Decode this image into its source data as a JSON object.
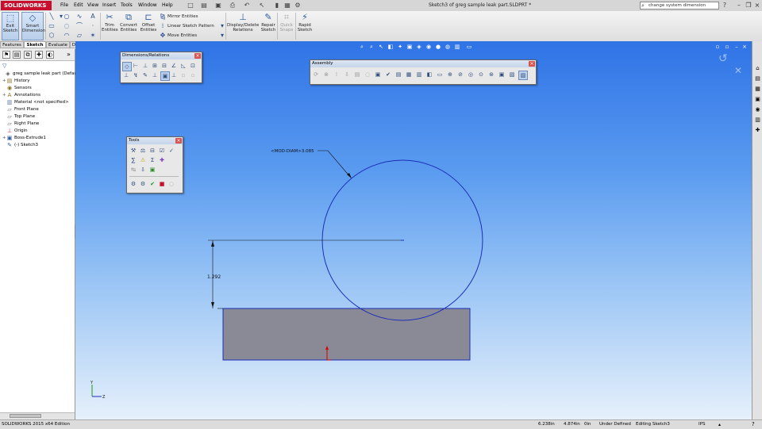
{
  "app": {
    "logo": "SOLIDWORKS",
    "menus": [
      "File",
      "Edit",
      "View",
      "Insert",
      "Tools",
      "Window",
      "Help"
    ],
    "doc_title": "Sketch3 of greg sample leak part.SLDPRT *",
    "search_placeholder": "change system dimension",
    "brand_color": "#c8102e"
  },
  "command_manager": {
    "exit_sketch": "Exit Sketch",
    "smart_dimension": "Smart Dimension",
    "trim_entities": "Trim Entities",
    "convert_entities": "Convert Entities",
    "offset_entities": "Offset Entities",
    "mirror_entities": "Mirror Entities",
    "linear_sketch_pattern": "Linear Sketch Pattern",
    "move_entities": "Move Entities",
    "display_delete_relations": "Display/Delete Relations",
    "repair_sketch": "Repair Sketch",
    "quick_snaps": "Quick Snaps",
    "rapid_sketch": "Rapid Sketch"
  },
  "tabs": [
    "Features",
    "Sketch",
    "Evaluate",
    "DimXpert"
  ],
  "active_tab": "Sketch",
  "tree": [
    {
      "label": "greg sample leak part  (Default<",
      "icon": "part-icon",
      "expander": "",
      "indent": 0
    },
    {
      "label": "History",
      "icon": "history-icon",
      "expander": "+",
      "indent": 1
    },
    {
      "label": "Sensors",
      "icon": "sensors-icon",
      "expander": "",
      "indent": 1
    },
    {
      "label": "Annotations",
      "icon": "annotations-icon",
      "expander": "+",
      "indent": 1
    },
    {
      "label": "Material <not specified>",
      "icon": "material-icon",
      "expander": "",
      "indent": 1
    },
    {
      "label": "Front Plane",
      "icon": "plane-icon",
      "expander": "",
      "indent": 1
    },
    {
      "label": "Top Plane",
      "icon": "plane-icon",
      "expander": "",
      "indent": 1
    },
    {
      "label": "Right Plane",
      "icon": "plane-icon",
      "expander": "",
      "indent": 1
    },
    {
      "label": "Origin",
      "icon": "origin-icon",
      "expander": "",
      "indent": 1
    },
    {
      "label": "Boss-Extrude1",
      "icon": "extrude-icon",
      "expander": "+",
      "indent": 1
    },
    {
      "label": "(-) Sketch3",
      "icon": "sketch-icon",
      "expander": "",
      "indent": 1
    }
  ],
  "dim_toolbar": {
    "title": "Dimensions/Relations"
  },
  "assembly_toolbar": {
    "title": "Assembly"
  },
  "tools_toolbar": {
    "title": "Tools"
  },
  "sketch": {
    "diameter_label": "<MOD-DIAM>3.085",
    "vertical_dim": "1.292",
    "sketch_color": "#1b2fb5",
    "body_color": "#8a8a96"
  },
  "status": {
    "edition": "SOLIDWORKS 2015 x64 Edition",
    "x": "6.238in",
    "y": "4.874in",
    "z": "0in",
    "state": "Under Defined",
    "editing": "Editing Sketch3",
    "units": "IPS"
  }
}
